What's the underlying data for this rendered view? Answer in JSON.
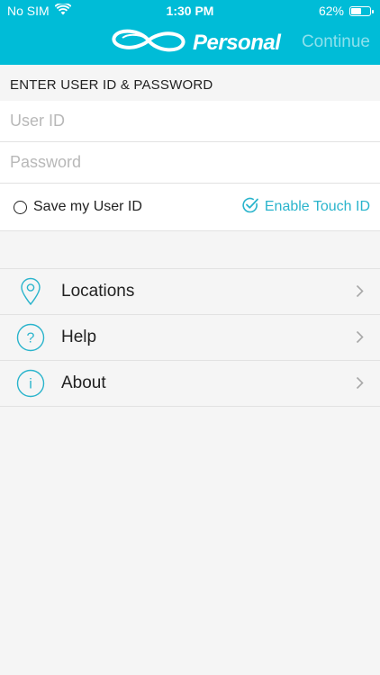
{
  "status_bar": {
    "carrier": "No SIM",
    "time": "1:30 PM",
    "battery_text": "62%",
    "battery_level": 0.62
  },
  "header": {
    "brand": "Personal",
    "continue_label": "Continue",
    "color": "#00bcd7"
  },
  "login": {
    "section_title": "ENTER USER ID & PASSWORD",
    "user_id_placeholder": "User ID",
    "user_id_value": "",
    "password_placeholder": "Password",
    "password_value": "",
    "save_user_id_label": "Save my User ID",
    "enable_touch_id_label": "Enable Touch ID",
    "accent": "#2ab4cc"
  },
  "menu": {
    "items": [
      {
        "label": "Locations",
        "icon": "location-pin-icon"
      },
      {
        "label": "Help",
        "icon": "question-icon"
      },
      {
        "label": "About",
        "icon": "info-icon"
      }
    ]
  }
}
